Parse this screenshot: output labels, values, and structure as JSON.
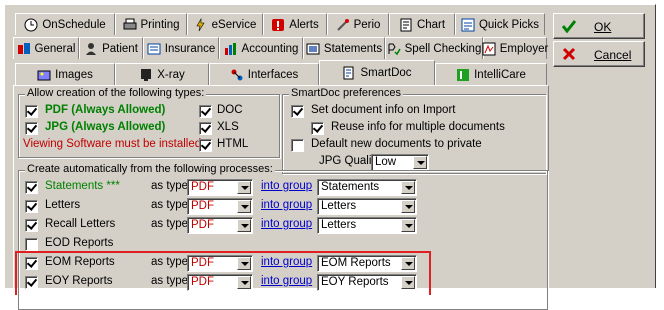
{
  "tabs_row1": [
    {
      "label": "OnSchedule",
      "icon": "clock-icon"
    },
    {
      "label": "Printing",
      "icon": "printer-icon"
    },
    {
      "label": "eService",
      "icon": "eservice-icon"
    },
    {
      "label": "Alerts",
      "icon": "alert-icon"
    },
    {
      "label": "Perio",
      "icon": "perio-icon"
    },
    {
      "label": "Chart",
      "icon": "chart-icon"
    },
    {
      "label": "Quick Picks",
      "icon": "quick-picks-icon"
    }
  ],
  "tabs_row2": [
    {
      "label": "General",
      "icon": "general-icon"
    },
    {
      "label": "Patient",
      "icon": "patient-icon"
    },
    {
      "label": "Insurance",
      "icon": "insurance-icon"
    },
    {
      "label": "Accounting",
      "icon": "accounting-icon"
    },
    {
      "label": "Statements",
      "icon": "statements-icon"
    },
    {
      "label": "Spell Checking",
      "icon": "spell-check-icon"
    },
    {
      "label": "Employer",
      "icon": "employer-icon"
    }
  ],
  "tabs_row3": [
    {
      "label": "Images",
      "icon": "images-icon"
    },
    {
      "label": "X-ray",
      "icon": "xray-icon"
    },
    {
      "label": "Interfaces",
      "icon": "interfaces-icon"
    },
    {
      "label": "SmartDoc",
      "icon": "smartdoc-icon",
      "active": true
    },
    {
      "label": "IntelliCare",
      "icon": "intellicare-icon"
    }
  ],
  "buttons": {
    "ok": "OK",
    "cancel": "Cancel"
  },
  "allow_group": {
    "title": "Allow creation of the following types:",
    "pdf": "PDF (Always Allowed)",
    "jpg": "JPG (Always Allowed)",
    "doc": "DOC",
    "xls": "XLS",
    "html": "HTML",
    "warning": "Viewing Software must be installed."
  },
  "prefs_group": {
    "title": "SmartDoc preferences",
    "set_doc_info": "Set document info on Import",
    "reuse_info": "Reuse info for multiple documents",
    "default_private": "Default new documents to private",
    "jpg_quality_label": "JPG Quality:",
    "jpg_quality_value": "Low"
  },
  "auto_group": {
    "title": "Create automatically from the following processes:",
    "as_type": "as type",
    "into_group": "into group",
    "rows": [
      {
        "name": "Statements ***",
        "checked": true,
        "type": "PDF",
        "group": "Statements",
        "green": true
      },
      {
        "name": "Letters",
        "checked": true,
        "type": "PDF",
        "group": "Letters"
      },
      {
        "name": "Recall Letters",
        "checked": true,
        "type": "PDF",
        "group": "Letters"
      },
      {
        "name": "EOD Reports",
        "checked": false
      },
      {
        "name": "EOM Reports",
        "checked": true,
        "type": "PDF",
        "group": "EOM Reports"
      },
      {
        "name": "EOY Reports",
        "checked": true,
        "type": "PDF",
        "group": "EOY Reports"
      }
    ]
  },
  "colors": {
    "face": "#d4d0c8",
    "green_text": "#008000",
    "warning_red": "#c00000",
    "link_blue": "#0000cc",
    "highlight_red": "#e02020"
  }
}
